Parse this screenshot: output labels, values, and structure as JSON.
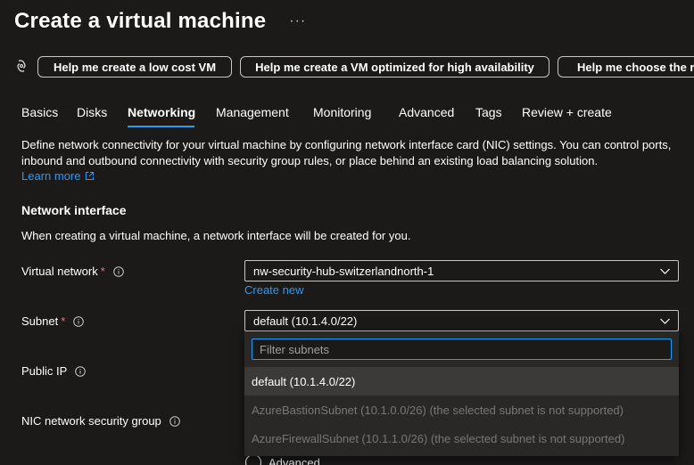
{
  "page": {
    "title": "Create a virtual machine",
    "more_label": "···"
  },
  "copilot": {
    "icon": "copilot-icon",
    "suggestions": [
      "Help me create a low cost VM",
      "Help me create a VM optimized for high availability",
      "Help me choose the right VM size"
    ]
  },
  "tabs": [
    {
      "label": "Basics",
      "active": false
    },
    {
      "label": "Disks",
      "active": false
    },
    {
      "label": "Networking",
      "active": true
    },
    {
      "label": "Management",
      "active": false
    },
    {
      "label": "Monitoring",
      "active": false
    },
    {
      "label": "Advanced",
      "active": false
    },
    {
      "label": "Tags",
      "active": false
    },
    {
      "label": "Review + create",
      "active": false
    }
  ],
  "intro": {
    "description": "Define network connectivity for your virtual machine by configuring network interface card (NIC) settings. You can control ports, inbound and outbound connectivity with security group rules, or place behind an existing load balancing solution.",
    "learn_more": "Learn more"
  },
  "network_interface": {
    "heading": "Network interface",
    "description": "When creating a virtual machine, a network interface will be created for you.",
    "virtual_network": {
      "label": "Virtual network",
      "required_mark": "*",
      "value": "nw-security-hub-switzerlandnorth-1",
      "create_new": "Create new"
    },
    "subnet": {
      "label": "Subnet",
      "required_mark": "*",
      "value": "default (10.1.4.0/22)",
      "filter_placeholder": "Filter subnets",
      "options": [
        {
          "label": "default (10.1.4.0/22)",
          "state": "selected"
        },
        {
          "label": "AzureBastionSubnet (10.1.0.0/26) (the selected subnet is not supported)",
          "state": "disabled"
        },
        {
          "label": "AzureFirewallSubnet (10.1.1.0/26) (the selected subnet is not supported)",
          "state": "disabled"
        }
      ]
    },
    "public_ip": {
      "label": "Public IP"
    },
    "nsg": {
      "label": "NIC network security group",
      "radio_option": "Advanced"
    }
  },
  "colors": {
    "background": "#1b1a19",
    "accent": "#2899f5",
    "required": "#f1707b",
    "disabled_text": "#797775"
  }
}
